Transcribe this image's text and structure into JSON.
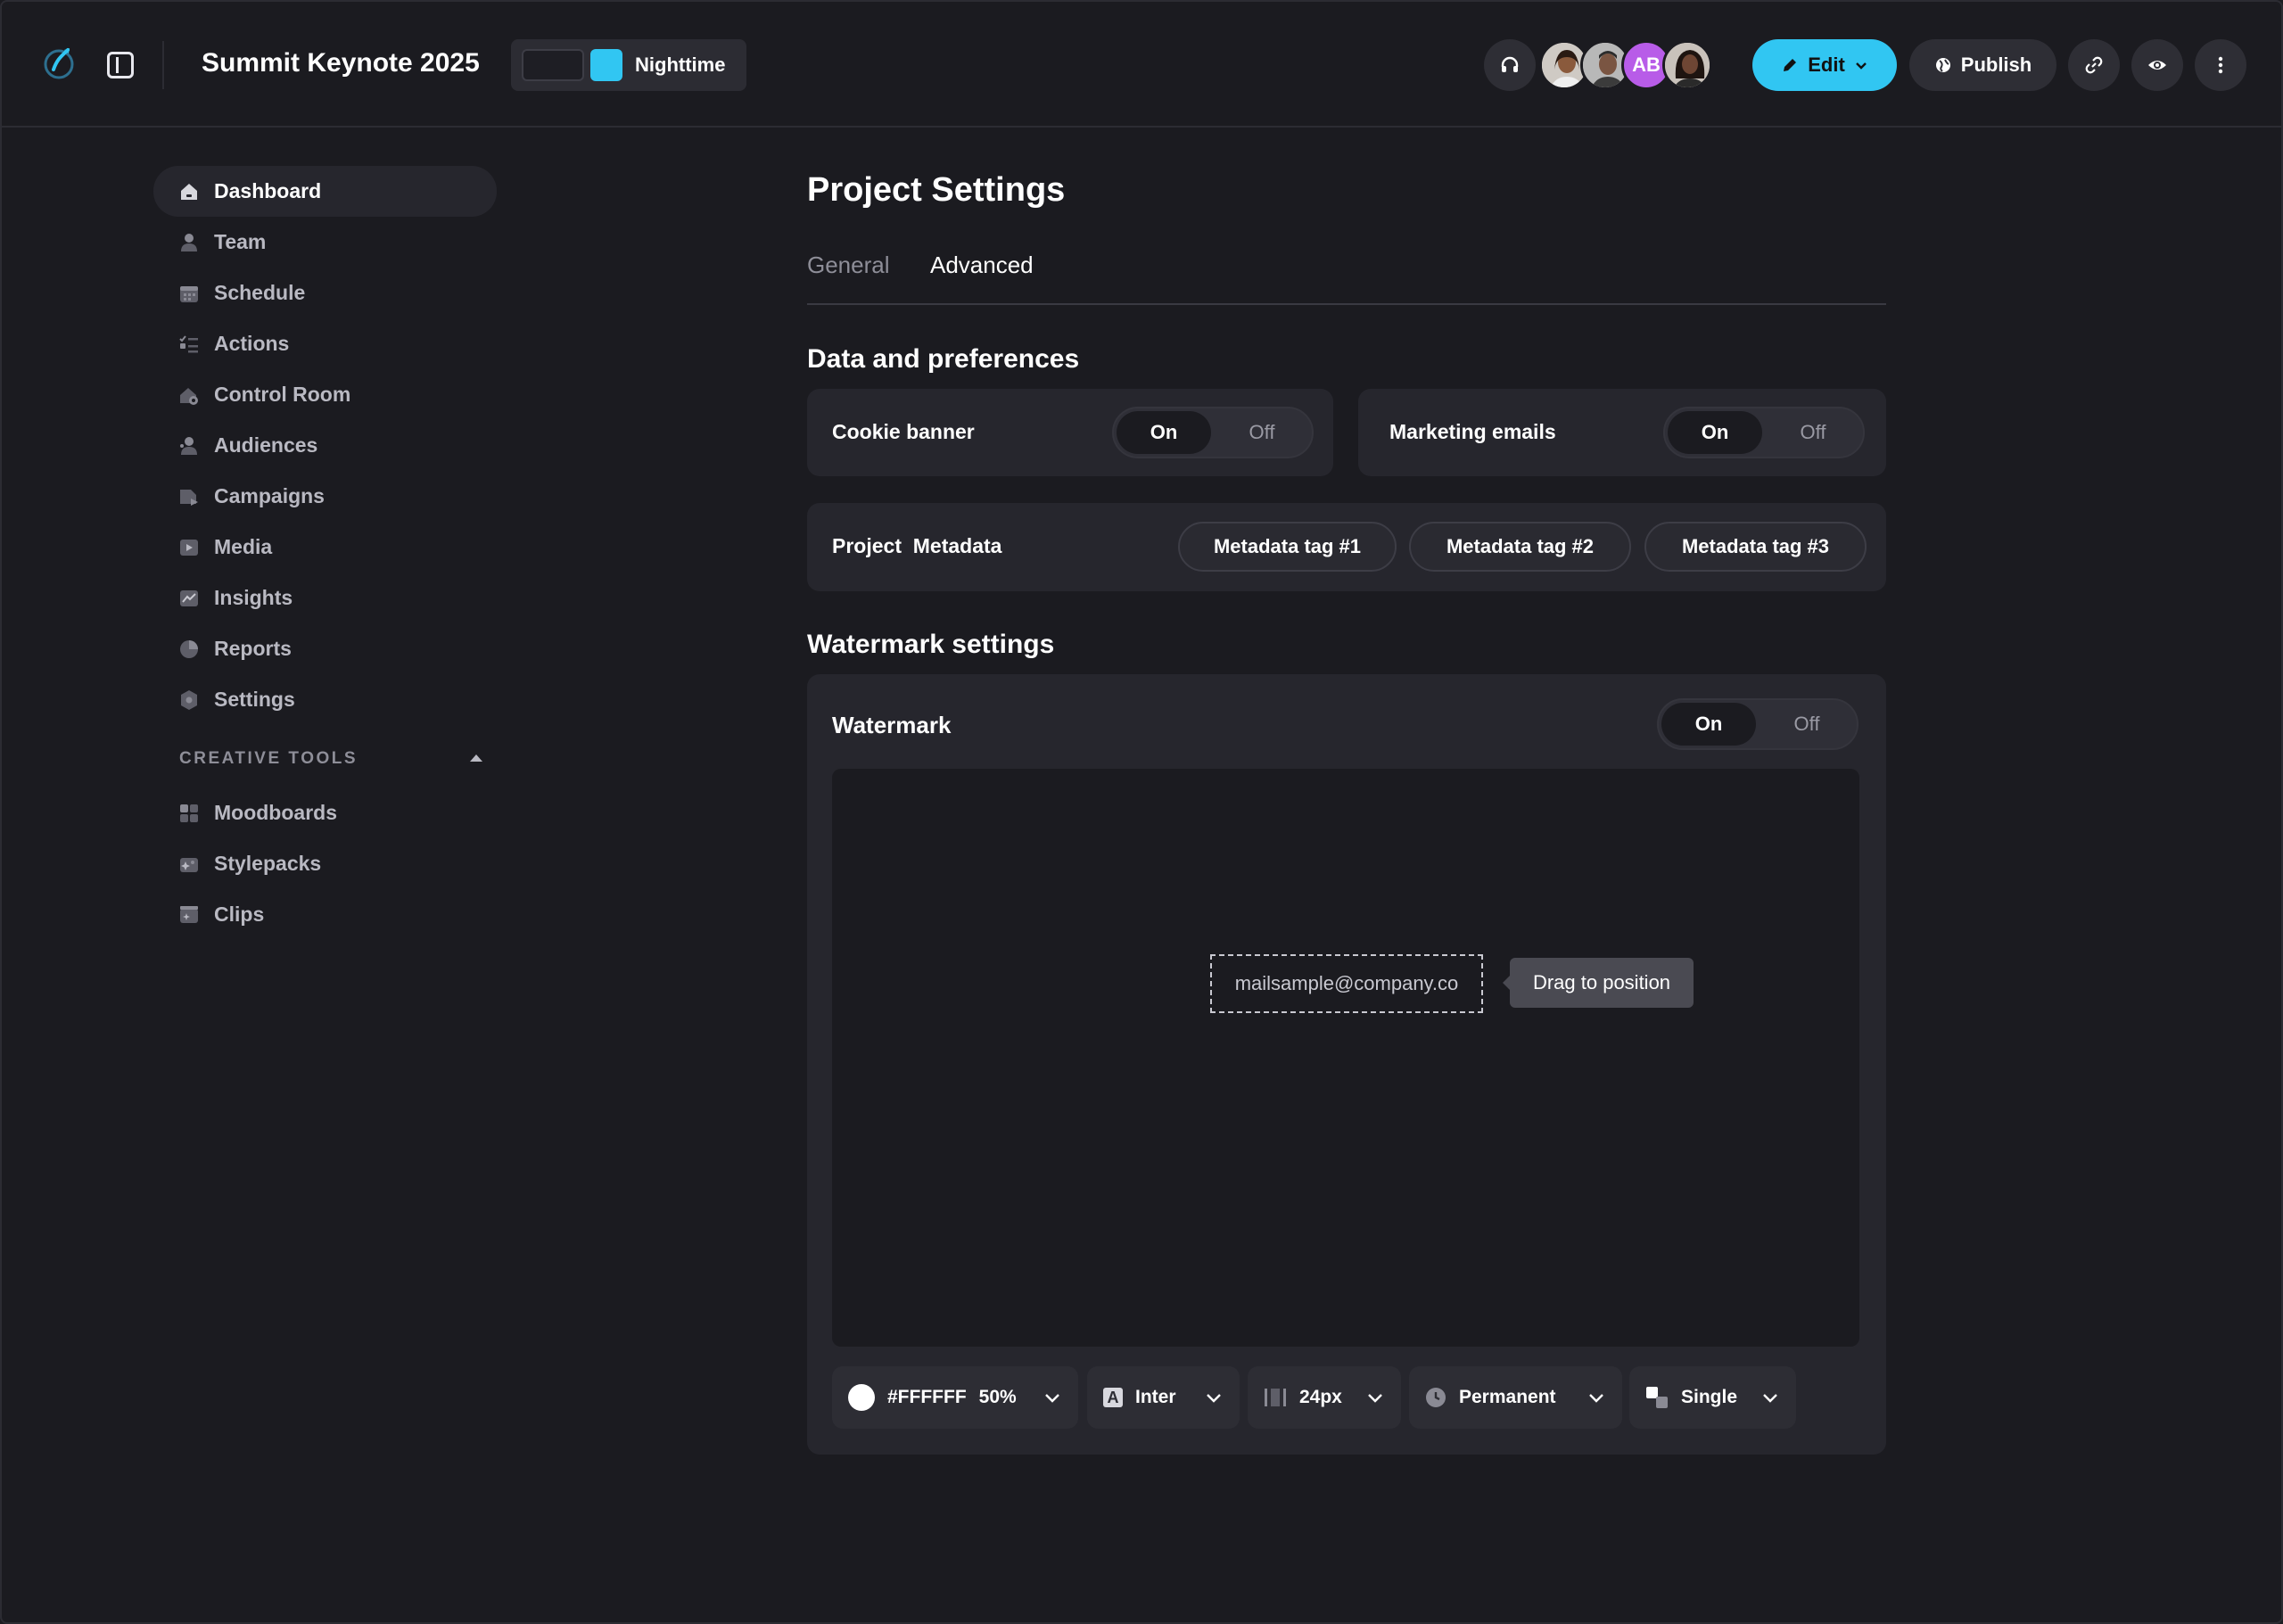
{
  "header": {
    "app_title": "Summit Keynote 2025",
    "theme_label": "Nighttime",
    "theme_color": "#31c6f2",
    "accent_color": "#31c6f2",
    "avatar_initials": "AB",
    "edit_label": "Edit",
    "publish_label": "Publish"
  },
  "sidebar": {
    "items": [
      {
        "label": "Dashboard",
        "icon": "home-icon"
      },
      {
        "label": "Team",
        "icon": "user-icon"
      },
      {
        "label": "Schedule",
        "icon": "calendar-icon"
      },
      {
        "label": "Actions",
        "icon": "checklist-icon"
      },
      {
        "label": "Control Room",
        "icon": "control-room-icon"
      },
      {
        "label": "Audiences",
        "icon": "audience-icon"
      },
      {
        "label": "Campaigns",
        "icon": "campaign-icon"
      },
      {
        "label": "Media",
        "icon": "play-icon"
      },
      {
        "label": "Insights",
        "icon": "insights-icon"
      },
      {
        "label": "Reports",
        "icon": "pie-chart-icon"
      },
      {
        "label": "Settings",
        "icon": "gear-icon"
      }
    ],
    "creative_tools": {
      "title": "CREATIVE TOOLS",
      "items": [
        {
          "label": "Moodboards",
          "icon": "moodboard-icon"
        },
        {
          "label": "Stylepacks",
          "icon": "stylepack-icon"
        },
        {
          "label": "Clips",
          "icon": "clips-icon"
        }
      ]
    }
  },
  "main": {
    "title": "Project Settings",
    "tabs": [
      {
        "label": "General"
      },
      {
        "label": "Advanced"
      }
    ],
    "data_prefs": {
      "title": "Data and preferences",
      "cookie_banner": {
        "label": "Cookie banner",
        "on": "On",
        "off": "Off"
      },
      "marketing_emails": {
        "label": "Marketing emails",
        "on": "On",
        "off": "Off"
      },
      "metadata": {
        "label": "Project  Metadata",
        "tags": [
          "Metadata tag #1",
          "Metadata tag #2",
          "Metadata tag #3"
        ]
      }
    },
    "watermark": {
      "title": "Watermark settings",
      "label": "Watermark",
      "on": "On",
      "off": "Off",
      "sample_text": "mailsample@company.co",
      "tooltip": "Drag to position",
      "controls": {
        "color": "#FFFFFF",
        "opacity": "50%",
        "font": "Inter",
        "size": "24px",
        "duration": "Permanent",
        "mode": "Single"
      }
    }
  }
}
